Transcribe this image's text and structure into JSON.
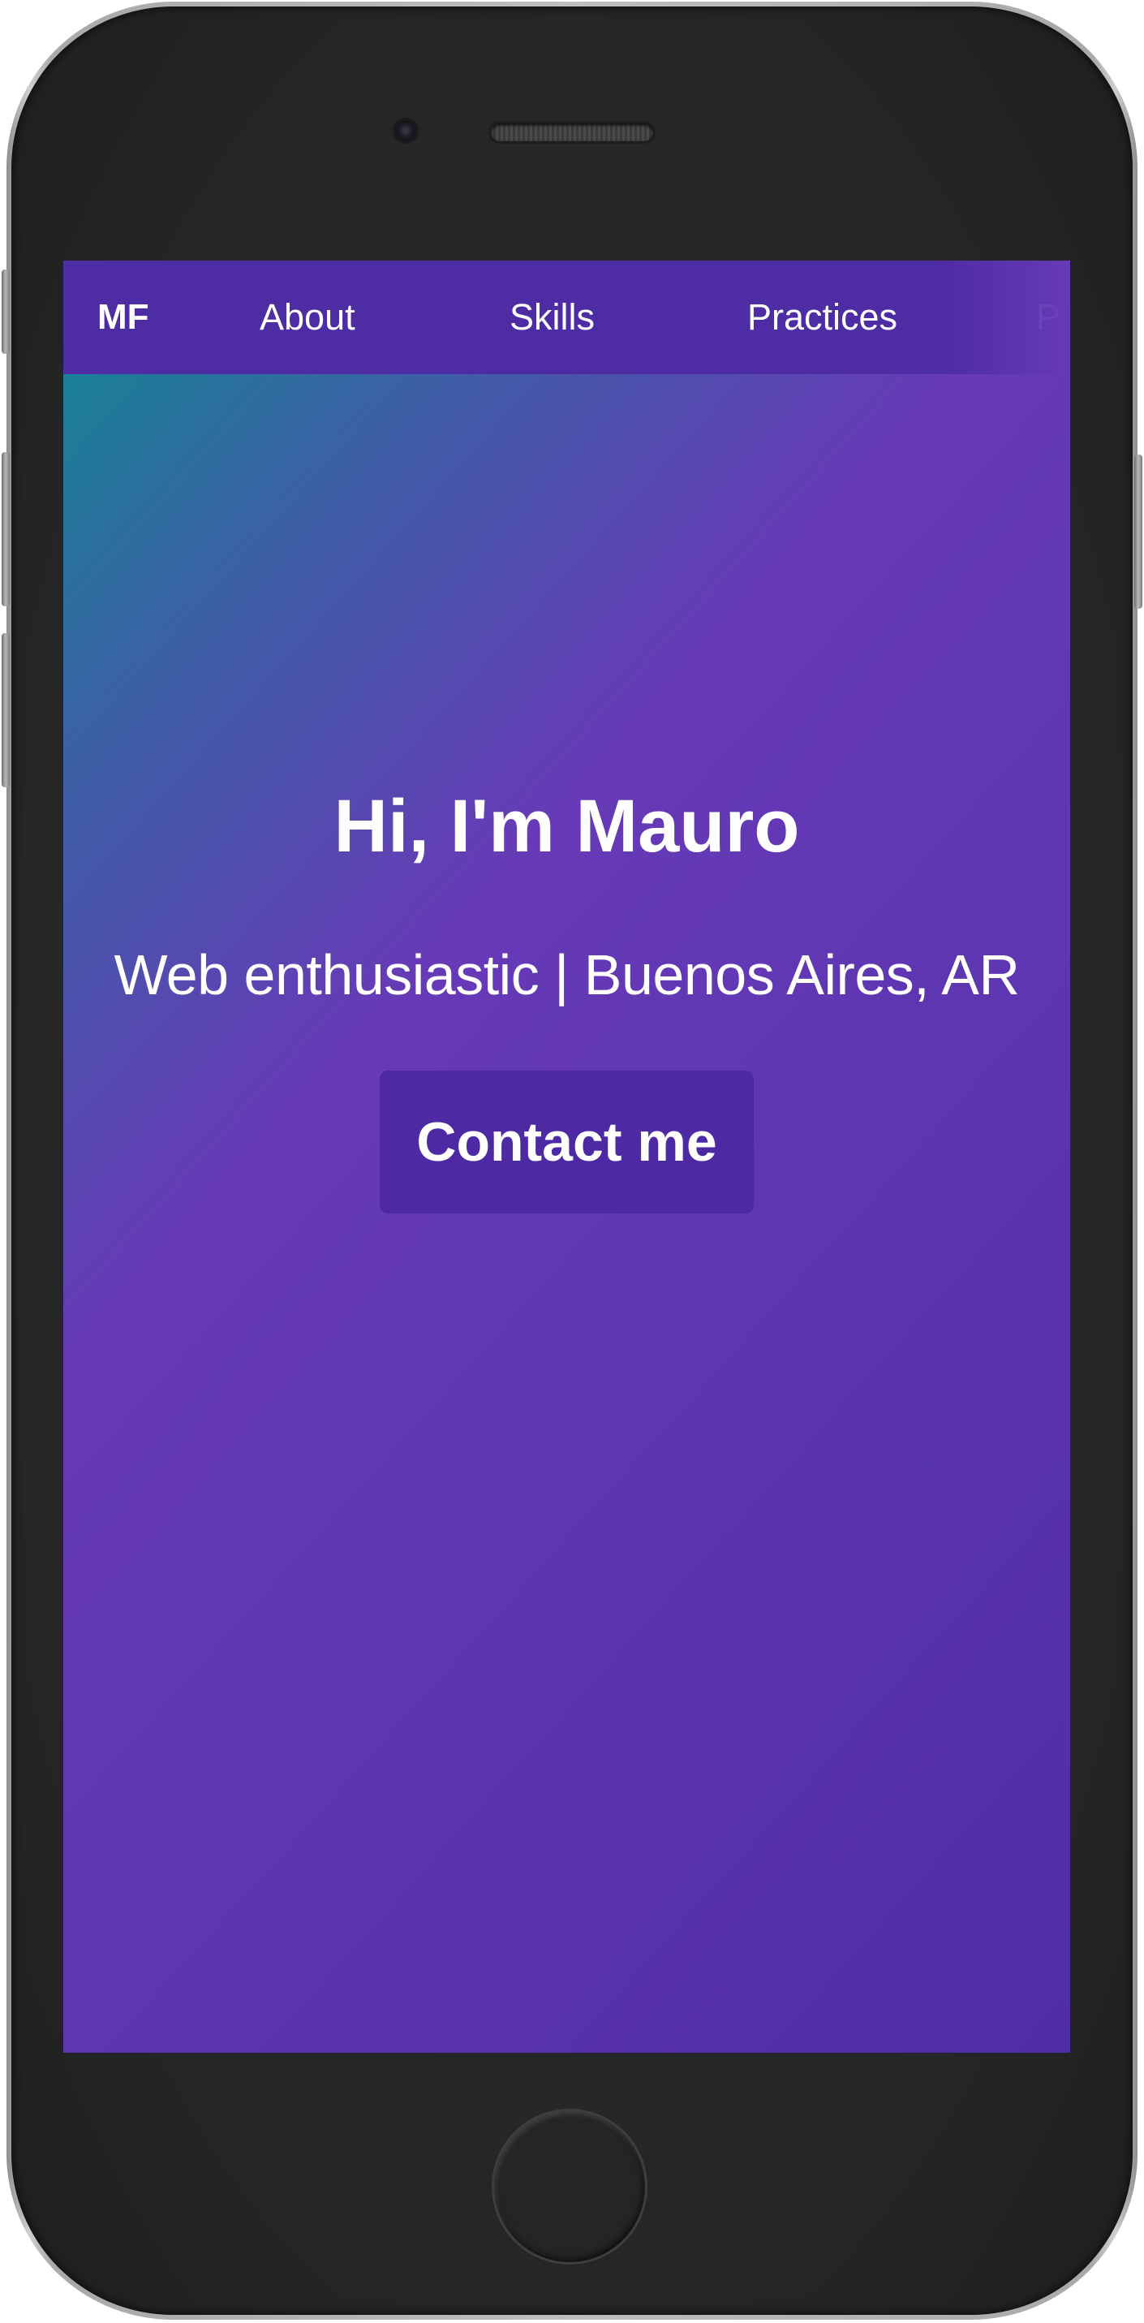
{
  "navbar": {
    "brand": "MF",
    "items": [
      {
        "label": "About"
      },
      {
        "label": "Skills"
      },
      {
        "label": "Practices"
      },
      {
        "label": "P"
      }
    ]
  },
  "hero": {
    "title": "Hi, I'm Mauro",
    "subtitle": "Web enthusiastic | Buenos Aires, AR",
    "cta_label": "Contact me"
  },
  "colors": {
    "navbar_bg": "#4e2ca4",
    "gradient_start": "#0f8a92",
    "gradient_mid": "#673ab7",
    "gradient_end": "#4f2da6",
    "button_bg": "#4d2aa4",
    "text": "#ffffff"
  },
  "device": {
    "frame": "phone-frame",
    "home_button": "home-button-icon",
    "camera": "front-camera-icon",
    "speaker": "earpiece-speaker-icon"
  }
}
